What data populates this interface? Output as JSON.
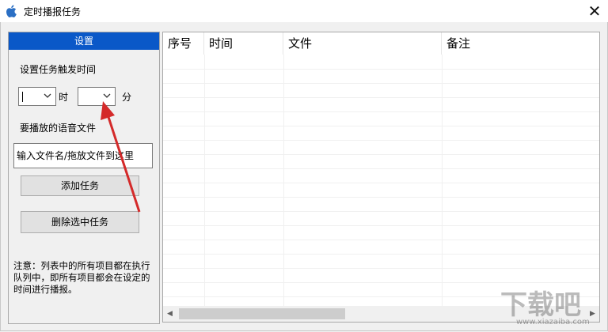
{
  "window": {
    "title": "定时播报任务",
    "close_glyph": "✕"
  },
  "settings": {
    "header": "设置",
    "trigger_label": "设置任务触发时间",
    "hour_value": "",
    "hour_unit": "时",
    "minute_value": "",
    "minute_unit": "分",
    "file_label": "要播放的语音文件",
    "file_placeholder": "输入文件名/拖放文件到这里",
    "add_button": "添加任务",
    "delete_button": "删除选中任务",
    "note": "注意：列表中的所有项目都在执行队列中，即所有项目都会在设定的时间进行播报。"
  },
  "task_list": {
    "columns": [
      "序号",
      "时间",
      "文件",
      "备注"
    ],
    "rows": []
  },
  "watermark": {
    "main": "下载吧",
    "sub": "www.xiazaiba.com"
  },
  "colors": {
    "header_bg": "#0a58c8",
    "annotation_arrow": "#d42a2a"
  }
}
